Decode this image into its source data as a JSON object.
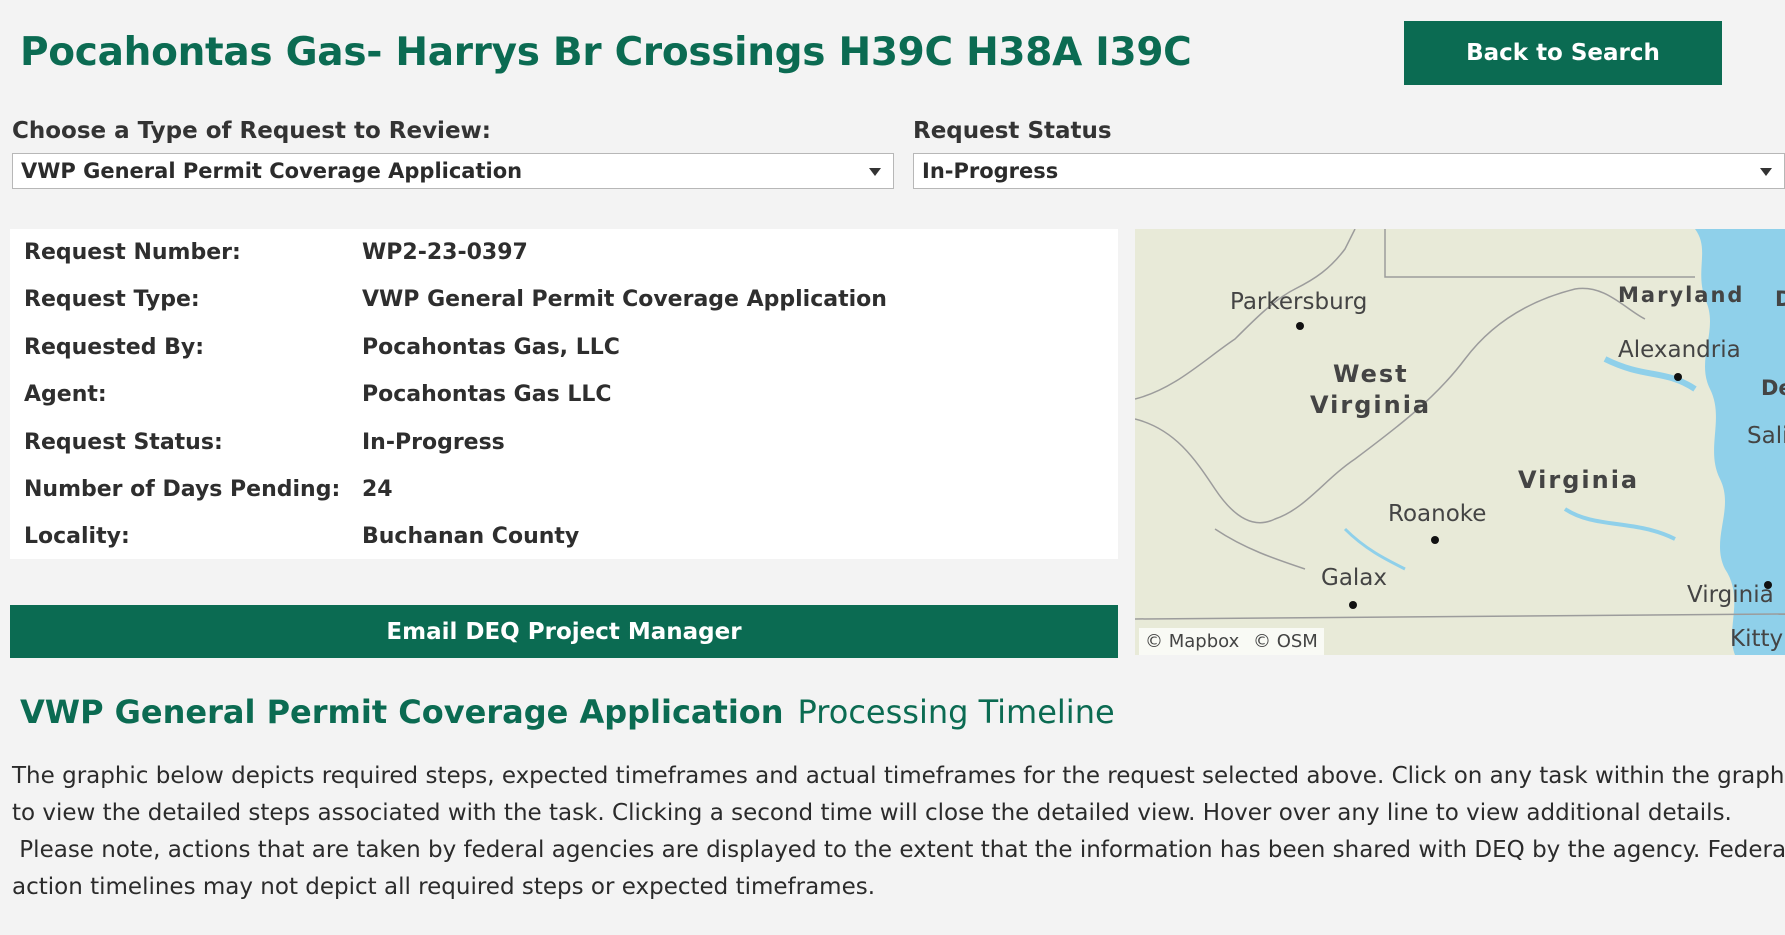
{
  "header": {
    "title": "Pocahontas Gas- Harrys Br Crossings H39C H38A I39C",
    "back_label": "Back to Search"
  },
  "filters": {
    "type_label": "Choose a Type of Request to Review:",
    "type_value": "VWP General Permit Coverage Application",
    "status_label": "Request Status",
    "status_value": "In-Progress"
  },
  "details": [
    {
      "label": "Request Number:",
      "value": "WP2-23-0397"
    },
    {
      "label": "Request Type:",
      "value": "VWP General Permit Coverage Application"
    },
    {
      "label": "Requested By:",
      "value": "Pocahontas Gas, LLC"
    },
    {
      "label": "Agent:",
      "value": "Pocahontas Gas LLC"
    },
    {
      "label": "Request Status:",
      "value": "In-Progress"
    },
    {
      "label": "Number of Days Pending:",
      "value": "24"
    },
    {
      "label": "Locality:",
      "value": "Buchanan County"
    }
  ],
  "email_label": "Email DEQ Project Manager",
  "map": {
    "labels": {
      "parkersburg": "Parkersburg",
      "maryland": "Maryland",
      "d": "D",
      "alexandria": "Alexandria",
      "west": "West",
      "virginia_wv": "Virginia",
      "de": "De",
      "sali": "Sali",
      "virginia": "Virginia",
      "roanoke": "Roanoke",
      "galax": "Galax",
      "virginia_beach": "Virginia",
      "kitty": "Kitty"
    },
    "attribution_mapbox": "© Mapbox",
    "attribution_osm": "© OSM",
    "colors": {
      "land": "#e8ead8",
      "water": "#8fd0ea",
      "border": "#9c9c9c"
    }
  },
  "timeline": {
    "title_bold": "VWP General Permit Coverage Application",
    "title_rest": "Processing Timeline",
    "lines": [
      "The graphic below depicts required steps, expected timeframes and actual timeframes for the request selected above. Click on any task within the graph",
      "to view the detailed steps associated with the task. Clicking a second time will close the detailed view. Hover over any line to view additional details.",
      " Please note, actions that are taken by federal agencies are displayed to the extent that the information has been shared with DEQ by the agency. Federal",
      "action timelines may not depict all required steps or expected timeframes."
    ]
  }
}
